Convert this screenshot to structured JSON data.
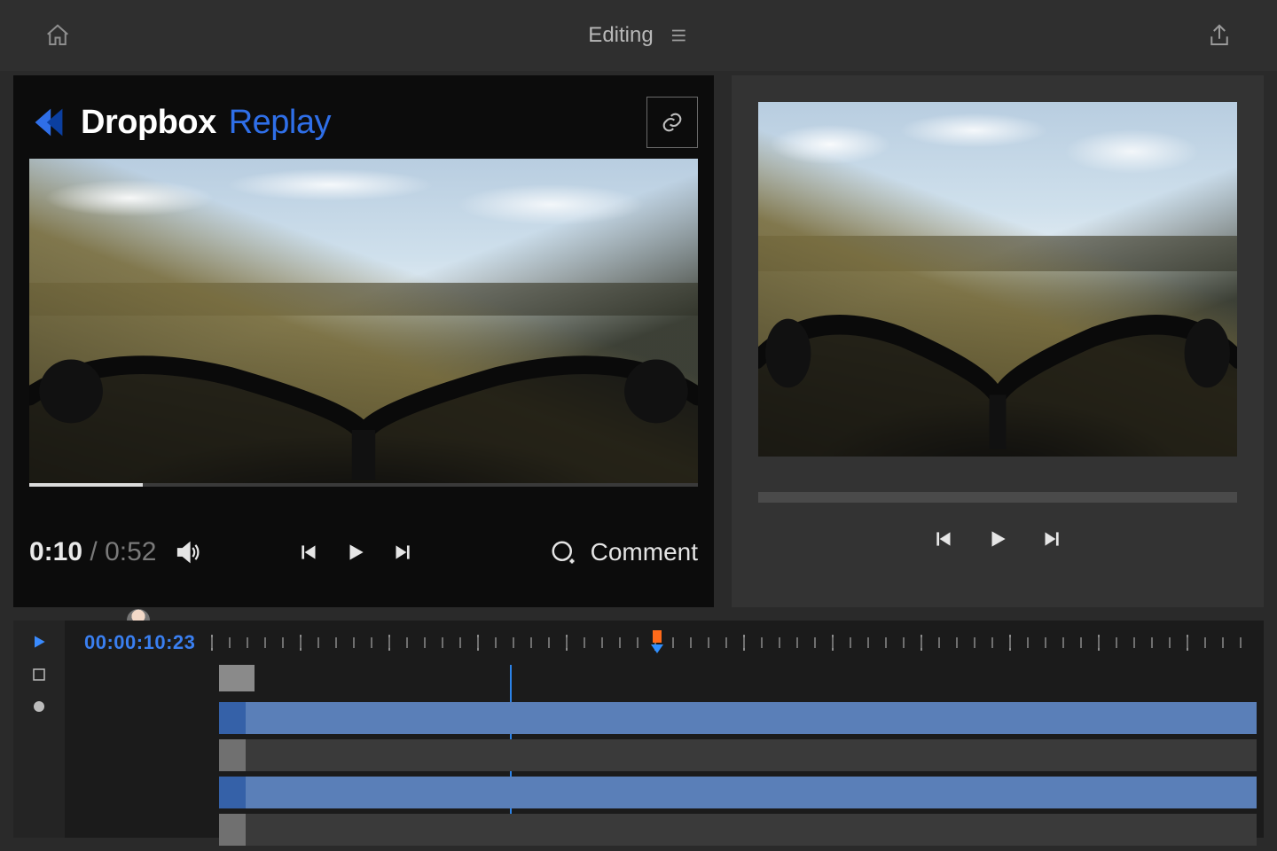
{
  "topbar": {
    "title": "Editing"
  },
  "logo": {
    "brand": "Dropbox",
    "product": "Replay"
  },
  "player": {
    "current_time": "0:10",
    "duration": "0:52",
    "progress_pct": 17,
    "comment_label": "Comment"
  },
  "timeline": {
    "timecode": "00:00:10:23",
    "track_count": 5,
    "playhead_frac": 0.42
  },
  "colors": {
    "accent_blue": "#2f6fe8",
    "playhead_blue": "#2f8fff",
    "marker_orange": "#ff6a1a",
    "track_blue": "#5a7fb8"
  }
}
